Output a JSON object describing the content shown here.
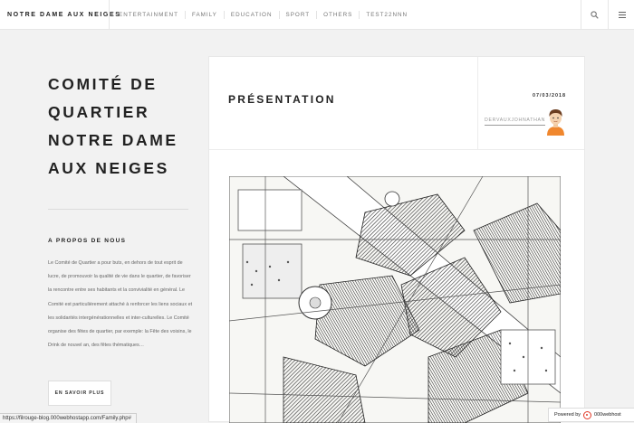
{
  "header": {
    "brand": "NOTRE DAME AUX NEIGES",
    "nav": [
      "ENTERTAINMENT",
      "FAMILY",
      "EDUCATION",
      "SPORT",
      "OTHERS",
      "TEST22NNN"
    ],
    "search_icon": "search-icon",
    "menu_icon": "hamburger-menu-icon"
  },
  "sidebar": {
    "title": "COMITÉ DE QUARTIER NOTRE DAME AUX NEIGES",
    "about_heading": "A PROPOS DE NOUS",
    "about_text": "Le Comité de Quartier a pour buts, en dehors de tout esprit de lucre, de promouvoir la qualité de vie dans le quartier, de favoriser la rencontre entre ses habitants et la convivialité en général. Le Comité est particulièrement attaché à renforcer les liens sociaux et les solidarités intergénérationnelles et inter-culturelles. Le Comité organise des fêtes de quartier, par exemple: la Fête des voisins, le Drink de nouvel an, des fêtes thématiques…",
    "more_button": "EN SAVOIR PLUS"
  },
  "post": {
    "title": "PRÉSENTATION",
    "date": "07/03/2018",
    "author": "DERVAUXJOHNATHAN",
    "avatar_icon": "avatar-icon",
    "image": "historic-map-of-neighbourhood"
  },
  "status_bar": {
    "url": "https://filrouge-blog.000webhostapp.com/Family.php#"
  },
  "badge": {
    "powered_by": "Powered by",
    "brand": "000webhost"
  },
  "colors": {
    "page_bg": "#f2f2f2",
    "text_dark": "#222222",
    "text_muted": "#666666",
    "badge_logo": "#e23a28"
  }
}
